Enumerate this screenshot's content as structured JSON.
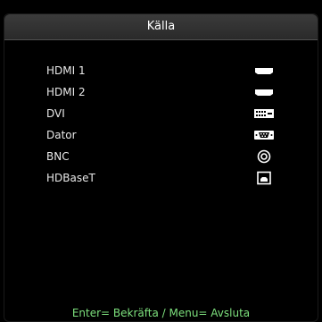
{
  "menu": {
    "title": "Källa",
    "sources": [
      {
        "label": "HDMI 1",
        "icon": "hdmi-port-icon"
      },
      {
        "label": "HDMI 2",
        "icon": "hdmi-port-icon"
      },
      {
        "label": "DVI",
        "icon": "dvi-port-icon"
      },
      {
        "label": "Dator",
        "icon": "vga-port-icon"
      },
      {
        "label": "BNC",
        "icon": "bnc-connector-icon"
      },
      {
        "label": "HDBaseT",
        "icon": "hdbaset-port-icon"
      }
    ],
    "footer": "Enter= Bekräfta / Menu= Avsluta"
  },
  "colors": {
    "background": "#000000",
    "header": "#333333",
    "text": "#e8e8e8",
    "footer_text": "#7de07d"
  }
}
